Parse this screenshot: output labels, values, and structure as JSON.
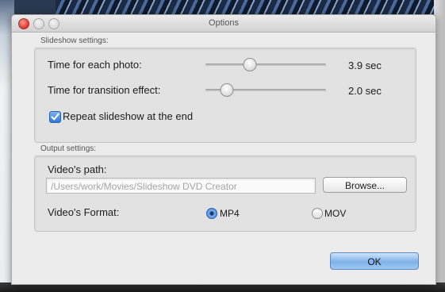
{
  "window": {
    "title": "Options"
  },
  "slideshow": {
    "group_label": "Slideshow settings:",
    "photo_time": {
      "label": "Time for each photo:",
      "value_text": "3.9 sec",
      "level": 0.37
    },
    "transition_time": {
      "label": "Time for transition effect:",
      "value_text": "2.0 sec",
      "level": 0.18
    },
    "repeat": {
      "label": "Repeat slideshow at the end",
      "checked": true
    }
  },
  "output": {
    "group_label": "Output settings:",
    "path_label": "Video's path:",
    "path_value": "/Users/work/Movies/Slideshow DVD Creator",
    "browse_label": "Browse...",
    "format_label": "Video's Format:",
    "formats": [
      {
        "label": "MP4",
        "selected": true
      },
      {
        "label": "MOV",
        "selected": false
      }
    ]
  },
  "footer": {
    "ok_label": "OK"
  },
  "colors": {
    "accent": "#3779d3",
    "close_button": "#e0443a"
  },
  "icons": {
    "close": "close-window-icon",
    "minimize": "minimize-window-icon",
    "zoom": "zoom-window-icon",
    "check": "checkmark-icon"
  }
}
